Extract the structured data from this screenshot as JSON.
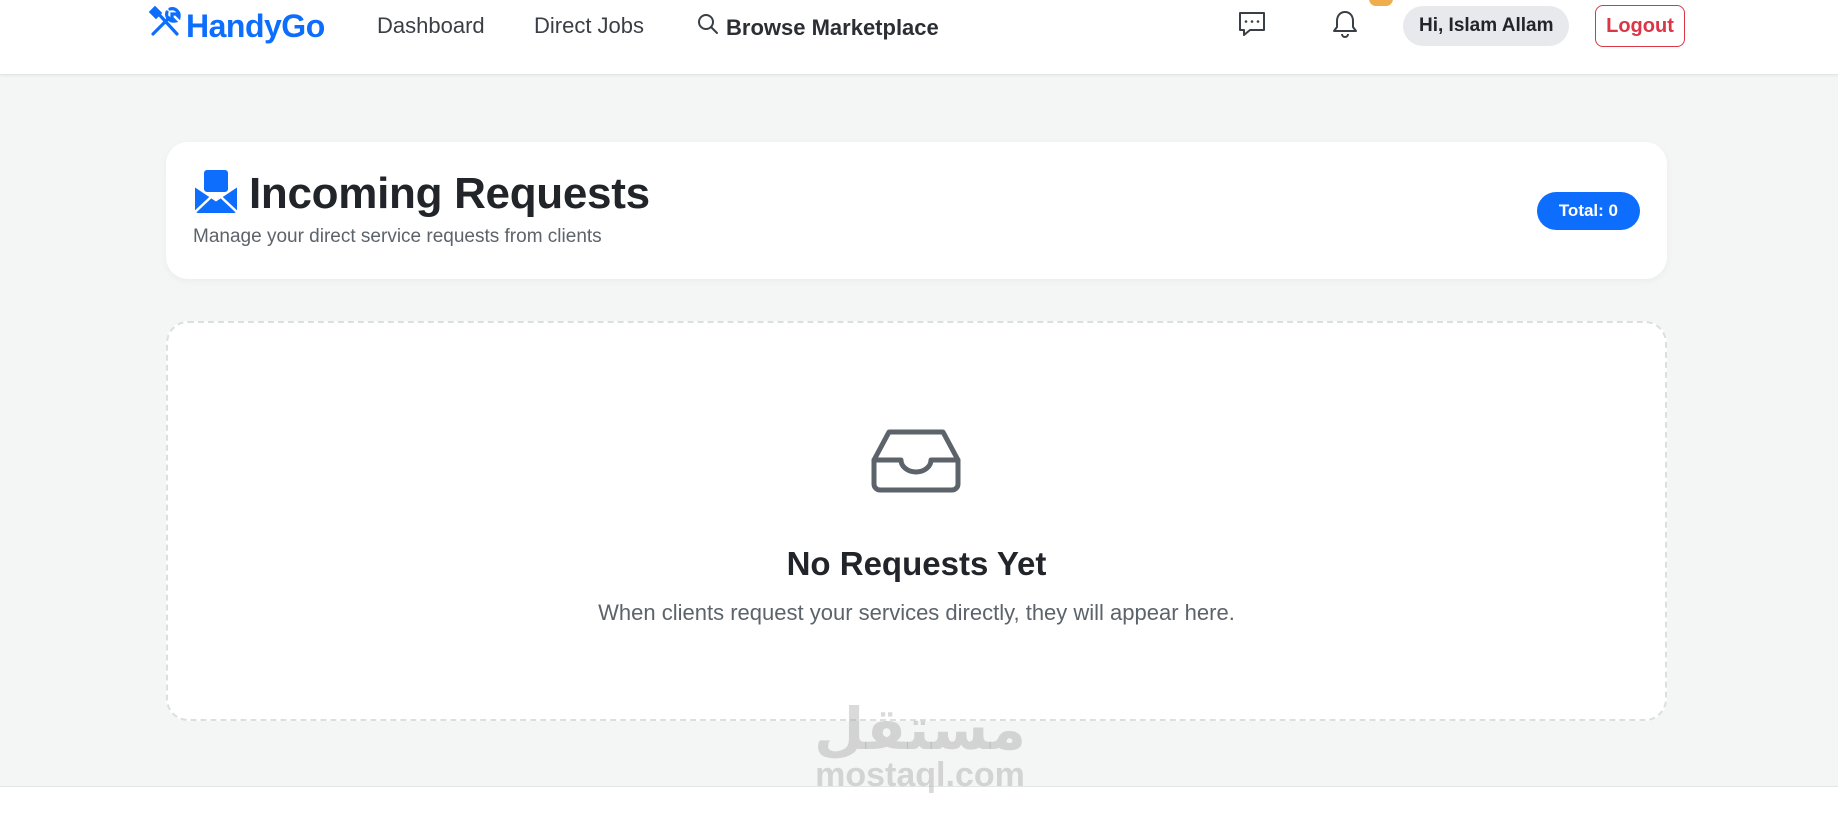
{
  "nav": {
    "brand": "HandyGo",
    "links": [
      "Dashboard",
      "Direct Jobs"
    ],
    "browse_label": "Browse Marketplace",
    "user_greeting": "Hi, Islam Allam",
    "logout_label": "Logout"
  },
  "header": {
    "title": "Incoming Requests",
    "subtitle": "Manage your direct service requests from clients",
    "total_badge": "Total: 0"
  },
  "empty_state": {
    "title": "No Requests Yet",
    "message": "When clients request your services directly, they will appear here."
  },
  "watermark": {
    "arabic": "مستقل",
    "latin": "mostaql.com"
  },
  "colors": {
    "primary": "#0d6efd",
    "danger": "#dc3545",
    "badge_warning": "#f0ad4e",
    "background": "#f4f5f5"
  },
  "icons": [
    "tools-icon",
    "search-icon",
    "chat-icon",
    "bell-icon",
    "envelope-open-icon",
    "inbox-icon"
  ]
}
